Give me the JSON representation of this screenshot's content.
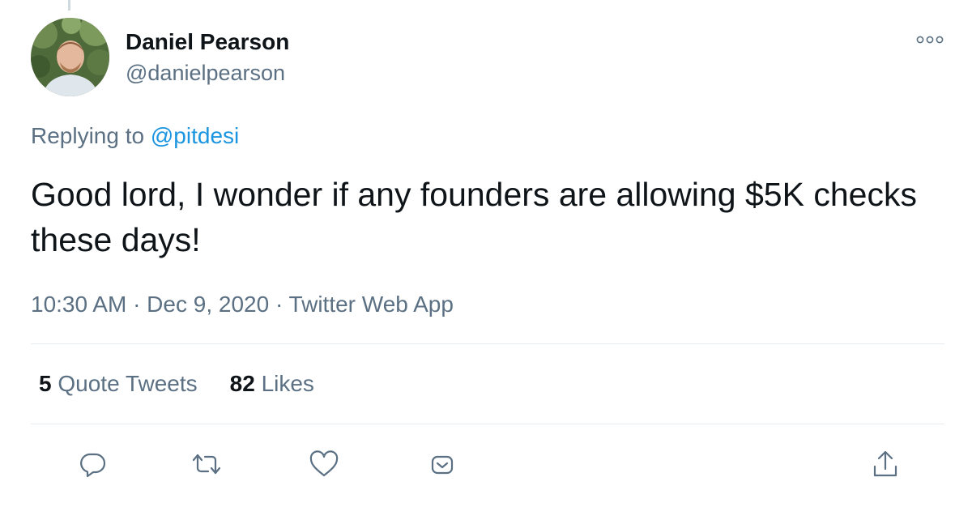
{
  "author": {
    "name": "Daniel Pearson",
    "handle": "@danielpearson"
  },
  "reply": {
    "prefix": "Replying to",
    "to_handle": "@pitdesi"
  },
  "tweet": {
    "text": "Good lord, I wonder if any founders are allowing $5K checks these days!",
    "meta": "10:30 AM · Dec 9, 2020 · Twitter Web App"
  },
  "stats": {
    "quote_count": "5",
    "quote_label": "Quote Tweets",
    "likes_count": "82",
    "likes_label": "Likes"
  },
  "icons": {
    "more": "more-icon",
    "reply": "reply-icon",
    "retweet": "retweet-icon",
    "like": "heart-icon",
    "dm": "dm-icon",
    "share": "share-icon"
  },
  "colors": {
    "text": "#0f1419",
    "secondary": "#5b7083",
    "link": "#1b95e0",
    "divider": "#e6ecf0"
  }
}
